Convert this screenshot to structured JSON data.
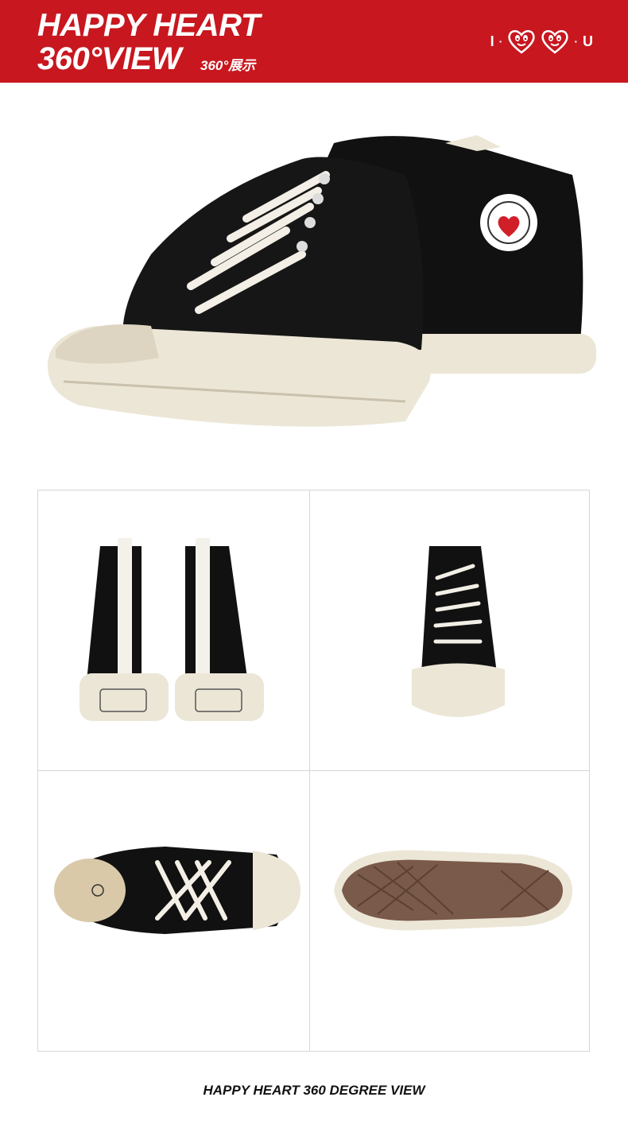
{
  "header": {
    "title_line1": "HAPPY HEART",
    "title_line2": "360°VIEW",
    "title_cn": "360°展示",
    "brand_left": "I",
    "brand_right": "U"
  },
  "colors": {
    "header_red": "#c8171f",
    "canvas_black": "#111111",
    "sole_cream": "#ece6d6",
    "outsole_brown": "#7a5a4a"
  },
  "views": [
    {
      "name": "back-view-image"
    },
    {
      "name": "front-side-view-image"
    },
    {
      "name": "top-view-image"
    },
    {
      "name": "sole-view-image"
    }
  ],
  "footer": {
    "caption": "HAPPY HEART 360 DEGREE VIEW"
  }
}
